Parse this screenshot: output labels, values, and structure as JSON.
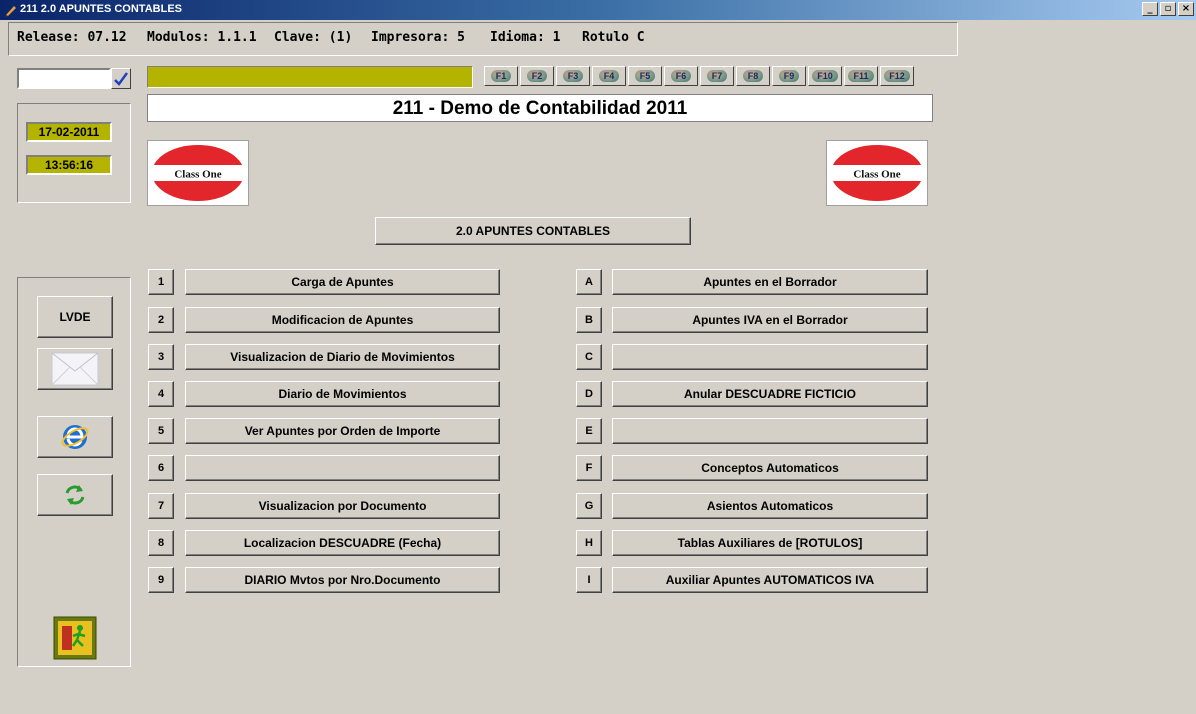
{
  "window": {
    "title": "211  2.0 APUNTES CONTABLES",
    "minimize": "_",
    "restore": "▫",
    "close": "×"
  },
  "infobar": {
    "release": "Release: 07.12",
    "modulos": "Modulos: 1.1.1",
    "clave": "Clave: (1)",
    "impresora": "Impresora: 5",
    "idioma": "Idioma: 1",
    "rotulo": "Rotulo  C"
  },
  "search": {
    "value": ""
  },
  "fkeys": [
    "F1",
    "F2",
    "F3",
    "F4",
    "F5",
    "F6",
    "F7",
    "F8",
    "F9",
    "F10",
    "F11",
    "F12"
  ],
  "company_title": "211 - Demo de Contabilidad 2011",
  "date": "17-02-2011",
  "time": "13:56:16",
  "logo_text": "Class One",
  "section_header": "2.0 APUNTES CONTABLES",
  "side": {
    "lvde": "LVDE"
  },
  "menu_left": [
    {
      "key": "1",
      "label": "Carga de Apuntes"
    },
    {
      "key": "2",
      "label": "Modificacion de Apuntes"
    },
    {
      "key": "3",
      "label": "Visualizacion de Diario de Movimientos"
    },
    {
      "key": "4",
      "label": "Diario de Movimientos"
    },
    {
      "key": "5",
      "label": "Ver Apuntes por Orden de Importe"
    },
    {
      "key": "6",
      "label": ""
    },
    {
      "key": "7",
      "label": "Visualizacion por Documento"
    },
    {
      "key": "8",
      "label": "Localizacion DESCUADRE (Fecha)"
    },
    {
      "key": "9",
      "label": "DIARIO Mvtos por Nro.Documento"
    }
  ],
  "menu_right": [
    {
      "key": "A",
      "label": "Apuntes en el Borrador"
    },
    {
      "key": "B",
      "label": "Apuntes IVA en el Borrador"
    },
    {
      "key": "C",
      "label": ""
    },
    {
      "key": "D",
      "label": "Anular DESCUADRE FICTICIO"
    },
    {
      "key": "E",
      "label": ""
    },
    {
      "key": "F",
      "label": "Conceptos Automaticos"
    },
    {
      "key": "G",
      "label": "Asientos Automaticos"
    },
    {
      "key": "H",
      "label": "Tablas Auxiliares de [ROTULOS]"
    },
    {
      "key": "I",
      "label": "Auxiliar Apuntes AUTOMATICOS IVA"
    }
  ],
  "colors": {
    "background": "#d4d0c8",
    "olive": "#b4b400",
    "logo_red": "#e3262b",
    "titlebar": "#0a246a"
  }
}
